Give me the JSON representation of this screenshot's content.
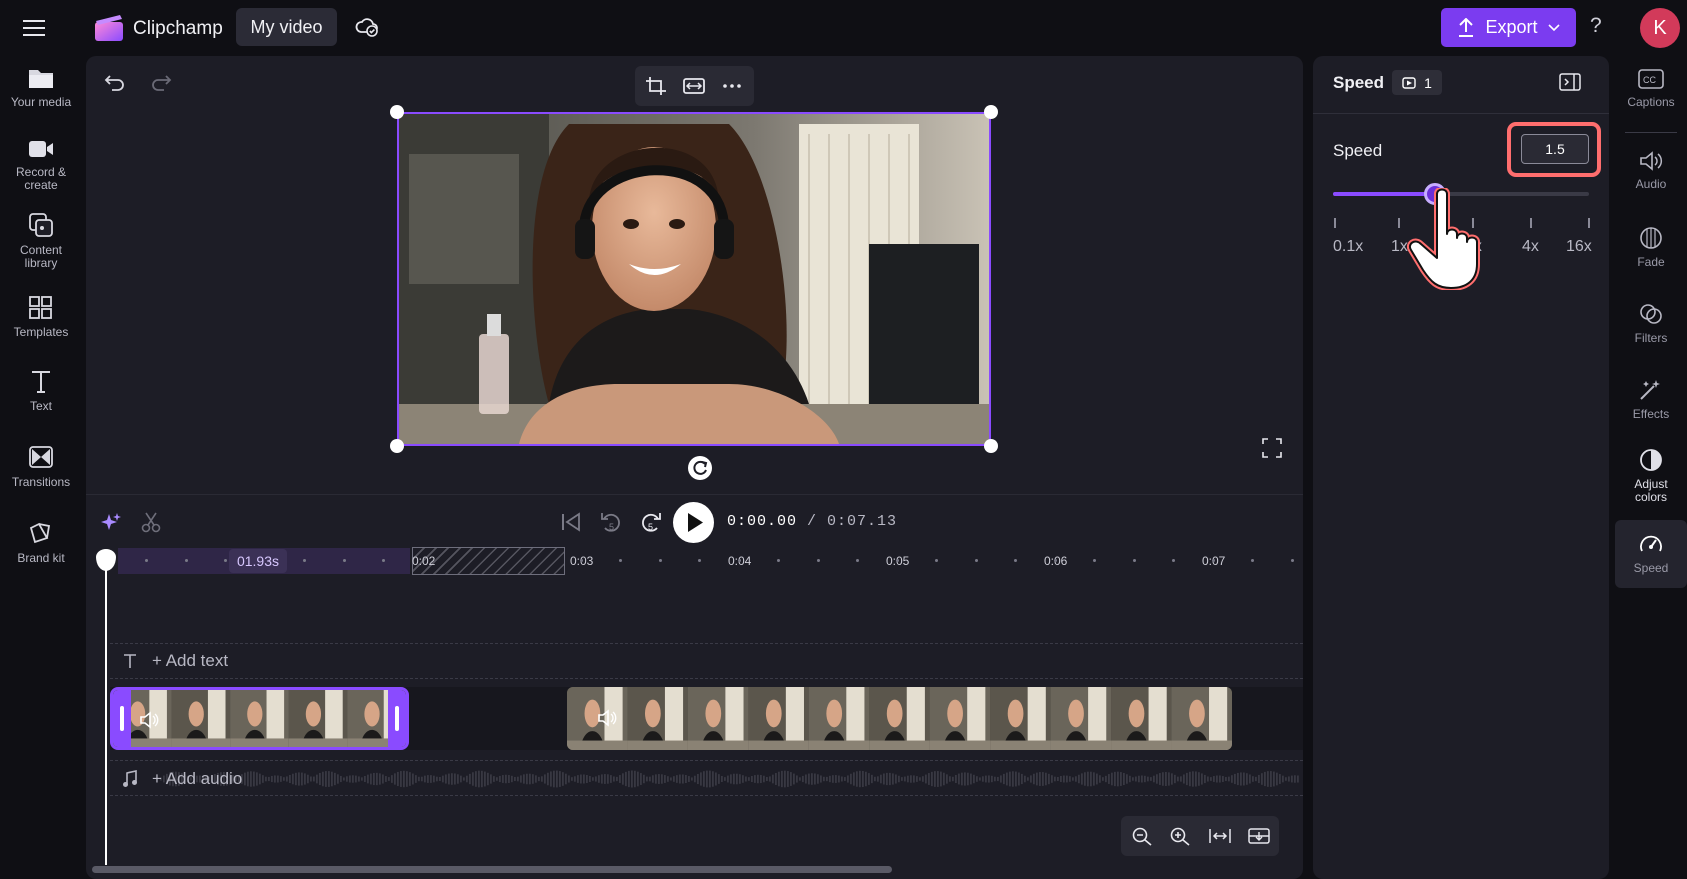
{
  "app": {
    "name": "Clipchamp",
    "project_tab": "My video"
  },
  "topbar": {
    "export_label": "Export",
    "help_label": "?",
    "avatar_initial": "K"
  },
  "left_nav": [
    {
      "label": "Your media",
      "icon": "folder-icon"
    },
    {
      "label": "Record &",
      "label2": "create",
      "icon": "camera-icon"
    },
    {
      "label": "Content",
      "label2": "library",
      "icon": "content-library-icon"
    },
    {
      "label": "Templates",
      "icon": "templates-icon"
    },
    {
      "label": "Text",
      "icon": "text-icon"
    },
    {
      "label": "Transitions",
      "icon": "transitions-icon"
    },
    {
      "label": "Brand kit",
      "icon": "brand-kit-icon"
    }
  ],
  "playback": {
    "current": "0:00.00",
    "total": "/ 0:07.13",
    "skip_label": "5"
  },
  "ruler": {
    "selection_badge": "01.93s",
    "ticks": [
      "0:02",
      "0:03",
      "0:04",
      "0:05",
      "0:06",
      "0:07"
    ]
  },
  "tracks": {
    "add_text": "+ Add text",
    "add_audio": "+ Add audio"
  },
  "panel": {
    "title": "Speed",
    "clip_badge": "1",
    "speed_label": "Speed",
    "speed_value": "1.5",
    "slider_fraction": 0.4,
    "tick_labels": [
      "0.1x",
      "1x",
      "2x",
      "4x",
      "16x"
    ]
  },
  "right_rail": [
    {
      "label": "Captions",
      "icon": "captions-icon"
    },
    {
      "label": "Audio",
      "icon": "audio-icon"
    },
    {
      "label": "Fade",
      "icon": "fade-icon"
    },
    {
      "label": "Filters",
      "icon": "filters-icon"
    },
    {
      "label": "Effects",
      "icon": "effects-icon"
    },
    {
      "label": "Adjust",
      "label2": "colors",
      "icon": "adjust-colors-icon"
    },
    {
      "label": "Speed",
      "icon": "speed-icon",
      "active": true
    }
  ],
  "colors": {
    "accent": "#8a4bff",
    "export": "#7b3cf0",
    "highlight": "#ff6e6e",
    "avatar": "#d23a5a"
  }
}
